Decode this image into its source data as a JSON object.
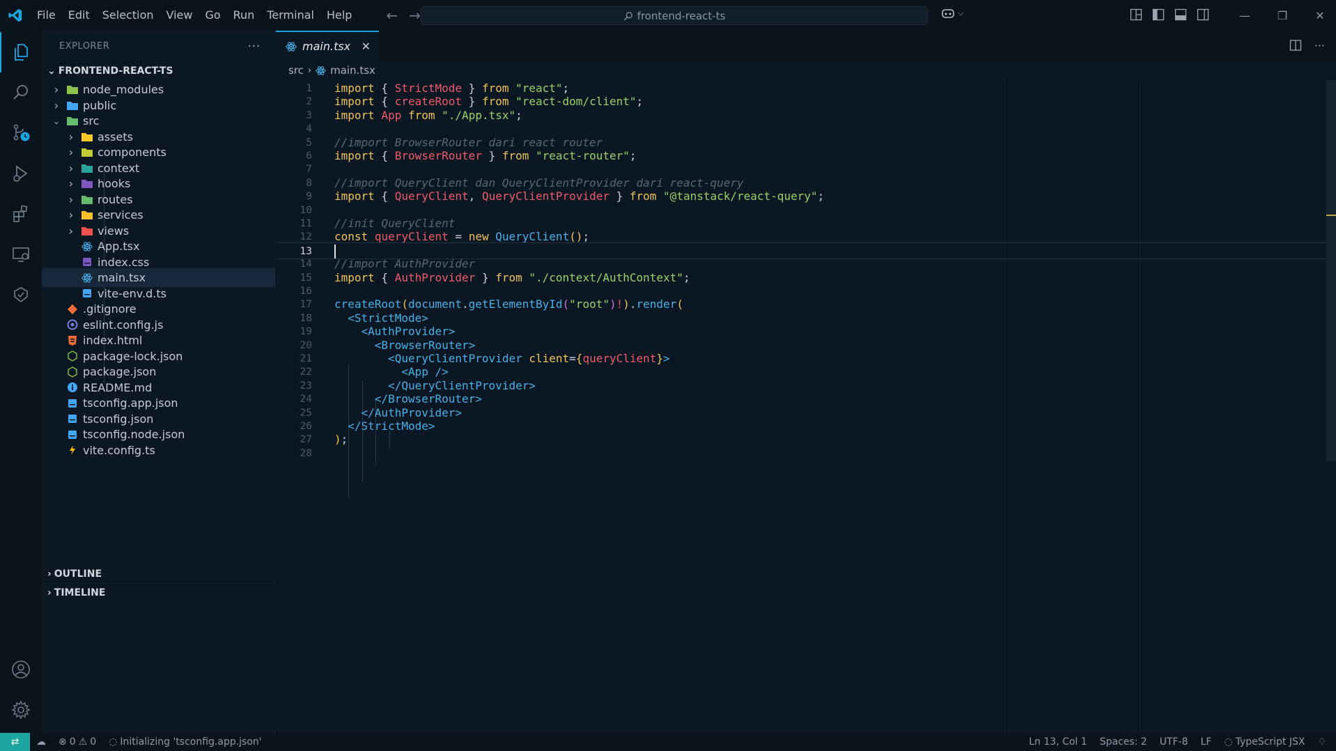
{
  "titlebar": {
    "menu": [
      "File",
      "Edit",
      "Selection",
      "View",
      "Go",
      "Run",
      "Terminal",
      "Help"
    ],
    "search_text": "frontend-react-ts"
  },
  "sidebar": {
    "title": "EXPLORER",
    "project": "FRONTEND-REACT-TS",
    "items": [
      {
        "label": "node_modules",
        "type": "folder",
        "depth": 1,
        "expanded": false,
        "color": "#8bc34a"
      },
      {
        "label": "public",
        "type": "folder",
        "depth": 1,
        "expanded": false,
        "color": "#42a5f5"
      },
      {
        "label": "src",
        "type": "folder",
        "depth": 1,
        "expanded": true,
        "color": "#66bb6a"
      },
      {
        "label": "assets",
        "type": "folder",
        "depth": 2,
        "expanded": false,
        "color": "#ffca28"
      },
      {
        "label": "components",
        "type": "folder",
        "depth": 2,
        "expanded": false,
        "color": "#c0ca33"
      },
      {
        "label": "context",
        "type": "folder",
        "depth": 2,
        "expanded": false,
        "color": "#26a69a"
      },
      {
        "label": "hooks",
        "type": "folder",
        "depth": 2,
        "expanded": false,
        "color": "#7e57c2"
      },
      {
        "label": "routes",
        "type": "folder",
        "depth": 2,
        "expanded": false,
        "color": "#66bb6a"
      },
      {
        "label": "services",
        "type": "folder",
        "depth": 2,
        "expanded": false,
        "color": "#fbc02d"
      },
      {
        "label": "views",
        "type": "folder",
        "depth": 2,
        "expanded": false,
        "color": "#ef5350"
      },
      {
        "label": "App.tsx",
        "type": "react",
        "depth": 2
      },
      {
        "label": "index.css",
        "type": "css",
        "depth": 2
      },
      {
        "label": "main.tsx",
        "type": "react",
        "depth": 2,
        "selected": true
      },
      {
        "label": "vite-env.d.ts",
        "type": "ts",
        "depth": 2
      },
      {
        "label": ".gitignore",
        "type": "git",
        "depth": 1
      },
      {
        "label": "eslint.config.js",
        "type": "eslint",
        "depth": 1
      },
      {
        "label": "index.html",
        "type": "html",
        "depth": 1
      },
      {
        "label": "package-lock.json",
        "type": "node",
        "depth": 1
      },
      {
        "label": "package.json",
        "type": "node",
        "depth": 1
      },
      {
        "label": "README.md",
        "type": "info",
        "depth": 1
      },
      {
        "label": "tsconfig.app.json",
        "type": "tsconfig",
        "depth": 1
      },
      {
        "label": "tsconfig.json",
        "type": "tsconfig",
        "depth": 1
      },
      {
        "label": "tsconfig.node.json",
        "type": "tsconfig",
        "depth": 1
      },
      {
        "label": "vite.config.ts",
        "type": "vite",
        "depth": 1
      }
    ],
    "outline": "OUTLINE",
    "timeline": "TIMELINE"
  },
  "editor": {
    "tab": "main.tsx",
    "breadcrumb": [
      "src",
      "main.tsx"
    ],
    "current_line": 13,
    "lines": [
      [
        [
          "kw",
          "import"
        ],
        [
          "pun",
          " { "
        ],
        [
          "id",
          "StrictMode"
        ],
        [
          "pun",
          " } "
        ],
        [
          "kw",
          "from"
        ],
        [
          "pun",
          " "
        ],
        [
          "str",
          "\"react\""
        ],
        [
          "pun",
          ";"
        ]
      ],
      [
        [
          "kw",
          "import"
        ],
        [
          "pun",
          " { "
        ],
        [
          "id",
          "createRoot"
        ],
        [
          "pun",
          " } "
        ],
        [
          "kw",
          "from"
        ],
        [
          "pun",
          " "
        ],
        [
          "str",
          "\"react-dom/client\""
        ],
        [
          "pun",
          ";"
        ]
      ],
      [
        [
          "kw",
          "import"
        ],
        [
          "pun",
          " "
        ],
        [
          "id",
          "App"
        ],
        [
          "pun",
          " "
        ],
        [
          "kw",
          "from"
        ],
        [
          "pun",
          " "
        ],
        [
          "str",
          "\"./App.tsx\""
        ],
        [
          "pun",
          ";"
        ]
      ],
      [],
      [
        [
          "cm",
          "//import BrowserRouter dari react router"
        ]
      ],
      [
        [
          "kw",
          "import"
        ],
        [
          "pun",
          " { "
        ],
        [
          "id",
          "BrowserRouter"
        ],
        [
          "pun",
          " } "
        ],
        [
          "kw",
          "from"
        ],
        [
          "pun",
          " "
        ],
        [
          "str",
          "\"react-router\""
        ],
        [
          "pun",
          ";"
        ]
      ],
      [],
      [
        [
          "cm",
          "//import QueryClient dan QueryClientProvider dari react-query"
        ]
      ],
      [
        [
          "kw",
          "import"
        ],
        [
          "pun",
          " { "
        ],
        [
          "id",
          "QueryClient"
        ],
        [
          "pun",
          ", "
        ],
        [
          "id",
          "QueryClientProvider"
        ],
        [
          "pun",
          " } "
        ],
        [
          "kw",
          "from"
        ],
        [
          "pun",
          " "
        ],
        [
          "str",
          "\"@tanstack/react-query\""
        ],
        [
          "pun",
          ";"
        ]
      ],
      [],
      [
        [
          "cm",
          "//init QueryClient"
        ]
      ],
      [
        [
          "kw",
          "const"
        ],
        [
          "pun",
          " "
        ],
        [
          "id",
          "queryClient"
        ],
        [
          "pun",
          " = "
        ],
        [
          "kw",
          "new"
        ],
        [
          "pun",
          " "
        ],
        [
          "fn",
          "QueryClient"
        ],
        [
          "br1",
          "()"
        ],
        [
          "pun",
          ";"
        ]
      ],
      [],
      [
        [
          "cm",
          "//import AuthProvider"
        ]
      ],
      [
        [
          "kw",
          "import"
        ],
        [
          "pun",
          " { "
        ],
        [
          "id",
          "AuthProvider"
        ],
        [
          "pun",
          " } "
        ],
        [
          "kw",
          "from"
        ],
        [
          "pun",
          " "
        ],
        [
          "str",
          "\"./context/AuthContext\""
        ],
        [
          "pun",
          ";"
        ]
      ],
      [],
      [
        [
          "fn",
          "createRoot"
        ],
        [
          "br1",
          "("
        ],
        [
          "fn",
          "document"
        ],
        [
          "pun",
          "."
        ],
        [
          "fn",
          "getElementById"
        ],
        [
          "br2",
          "("
        ],
        [
          "str",
          "\"root\""
        ],
        [
          "br2",
          ")"
        ],
        [
          "id",
          "!"
        ],
        [
          "br1",
          ")"
        ],
        [
          "pun",
          "."
        ],
        [
          "fn",
          "render"
        ],
        [
          "br1",
          "("
        ]
      ],
      [
        [
          "pun",
          "  "
        ],
        [
          "tag",
          "<StrictMode>"
        ]
      ],
      [
        [
          "pun",
          "    "
        ],
        [
          "tag",
          "<AuthProvider>"
        ]
      ],
      [
        [
          "pun",
          "      "
        ],
        [
          "tag",
          "<BrowserRouter>"
        ]
      ],
      [
        [
          "pun",
          "        "
        ],
        [
          "tag",
          "<QueryClientProvider"
        ],
        [
          "pun",
          " "
        ],
        [
          "attr",
          "client"
        ],
        [
          "pun",
          "="
        ],
        [
          "br1",
          "{"
        ],
        [
          "id",
          "queryClient"
        ],
        [
          "br1",
          "}"
        ],
        [
          "tag",
          ">"
        ]
      ],
      [
        [
          "pun",
          "          "
        ],
        [
          "tag",
          "<App />"
        ]
      ],
      [
        [
          "pun",
          "        "
        ],
        [
          "tag",
          "</QueryClientProvider>"
        ]
      ],
      [
        [
          "pun",
          "      "
        ],
        [
          "tag",
          "</BrowserRouter>"
        ]
      ],
      [
        [
          "pun",
          "    "
        ],
        [
          "tag",
          "</AuthProvider>"
        ]
      ],
      [
        [
          "pun",
          "  "
        ],
        [
          "tag",
          "</StrictMode>"
        ]
      ],
      [
        [
          "br1",
          ")"
        ],
        [
          "pun",
          ";"
        ]
      ],
      []
    ]
  },
  "statusbar": {
    "errors": "0",
    "warnings": "0",
    "message": "Initializing 'tsconfig.app.json'",
    "position": "Ln 13, Col 1",
    "spaces": "Spaces: 2",
    "encoding": "UTF-8",
    "eol": "LF",
    "language": "TypeScript JSX"
  }
}
